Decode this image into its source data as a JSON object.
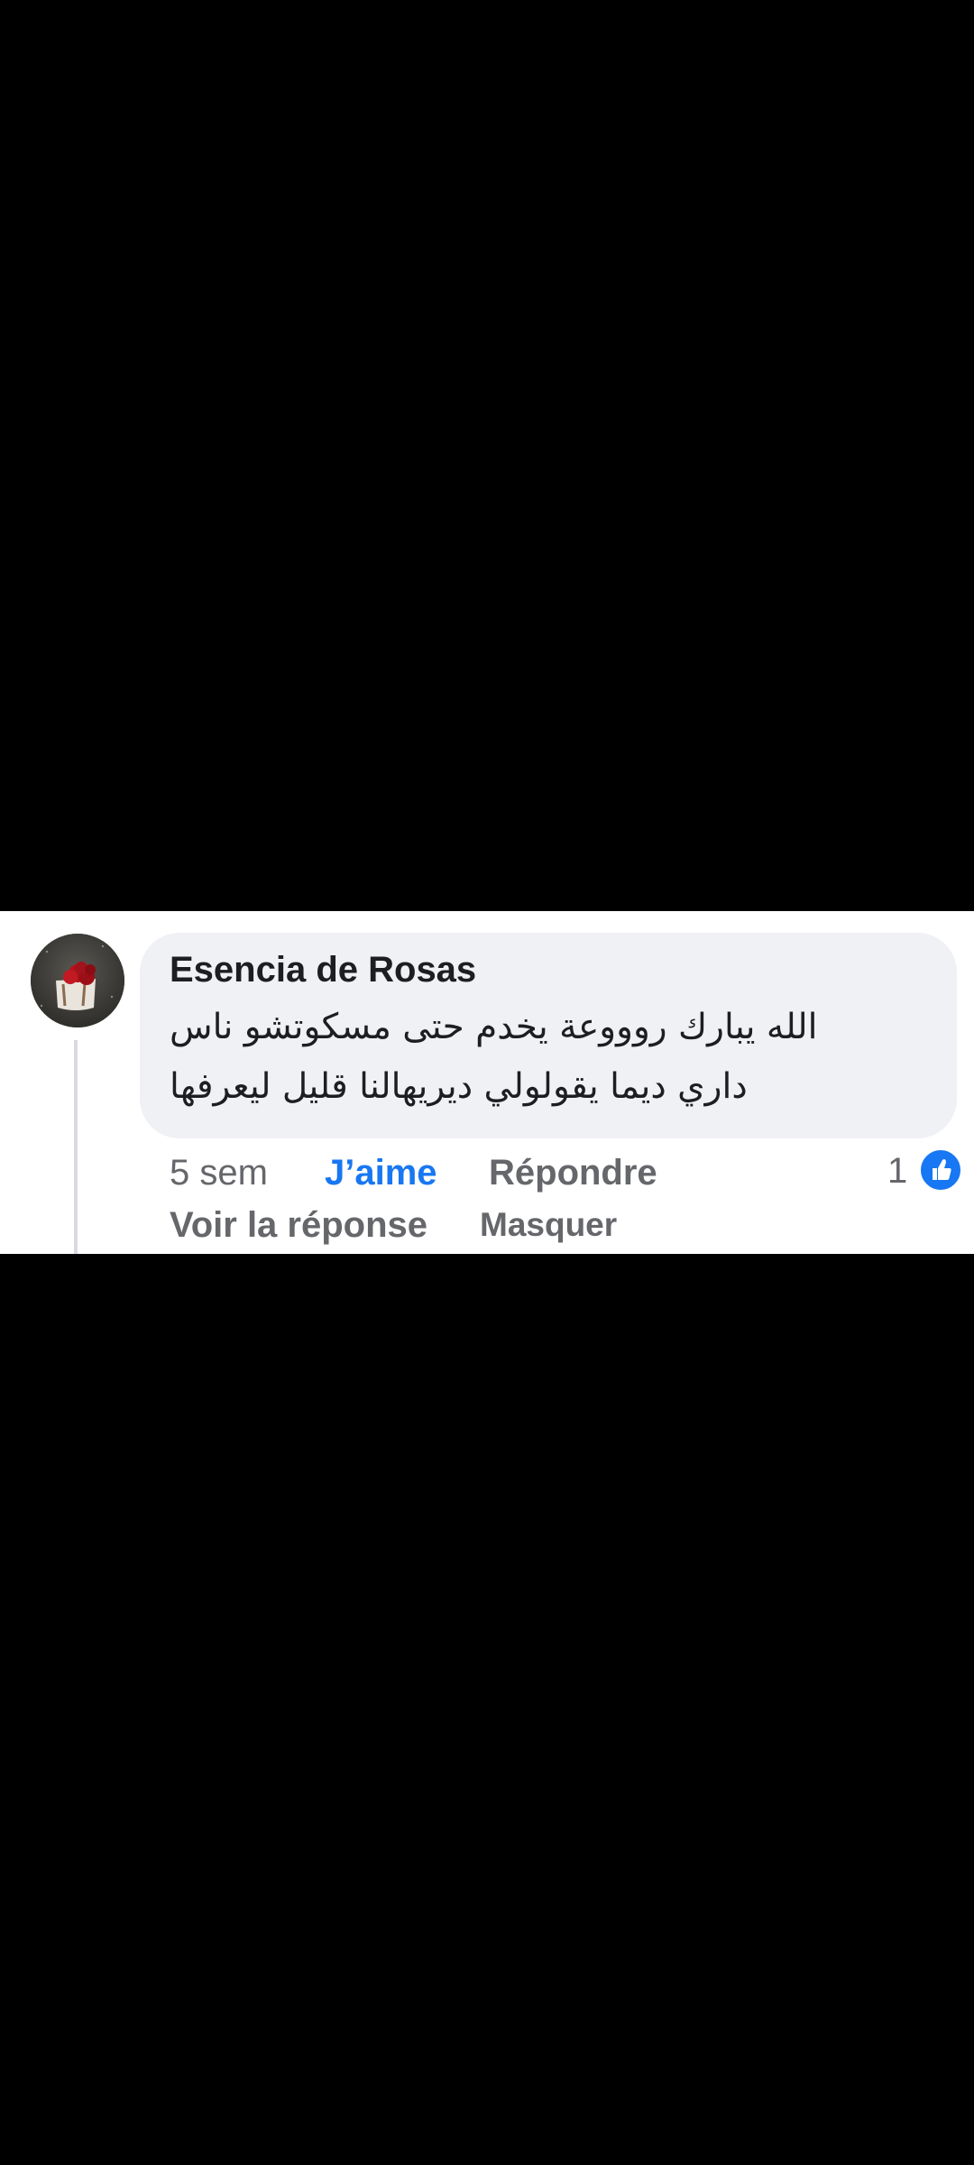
{
  "comment": {
    "author": "Esencia de Rosas",
    "text_lines": [
      "الله يبارك روووعة يخدم حتى مسكوتشو ناس",
      "داري ديما يقولولي ديريهالنا قليل ليعرفها"
    ],
    "time": "5 sem",
    "like_label": "J’aime",
    "reply_label": "Répondre",
    "reaction_count": "1",
    "reaction_type": "like-icon",
    "view_reply_label": "Voir la réponse",
    "hide_label": "Masquer"
  },
  "colors": {
    "accent": "#1877f2",
    "bubble": "#eff1f5",
    "secondary_text": "#65676b",
    "primary_text": "#1c1e21",
    "background_outside": "#000000"
  }
}
